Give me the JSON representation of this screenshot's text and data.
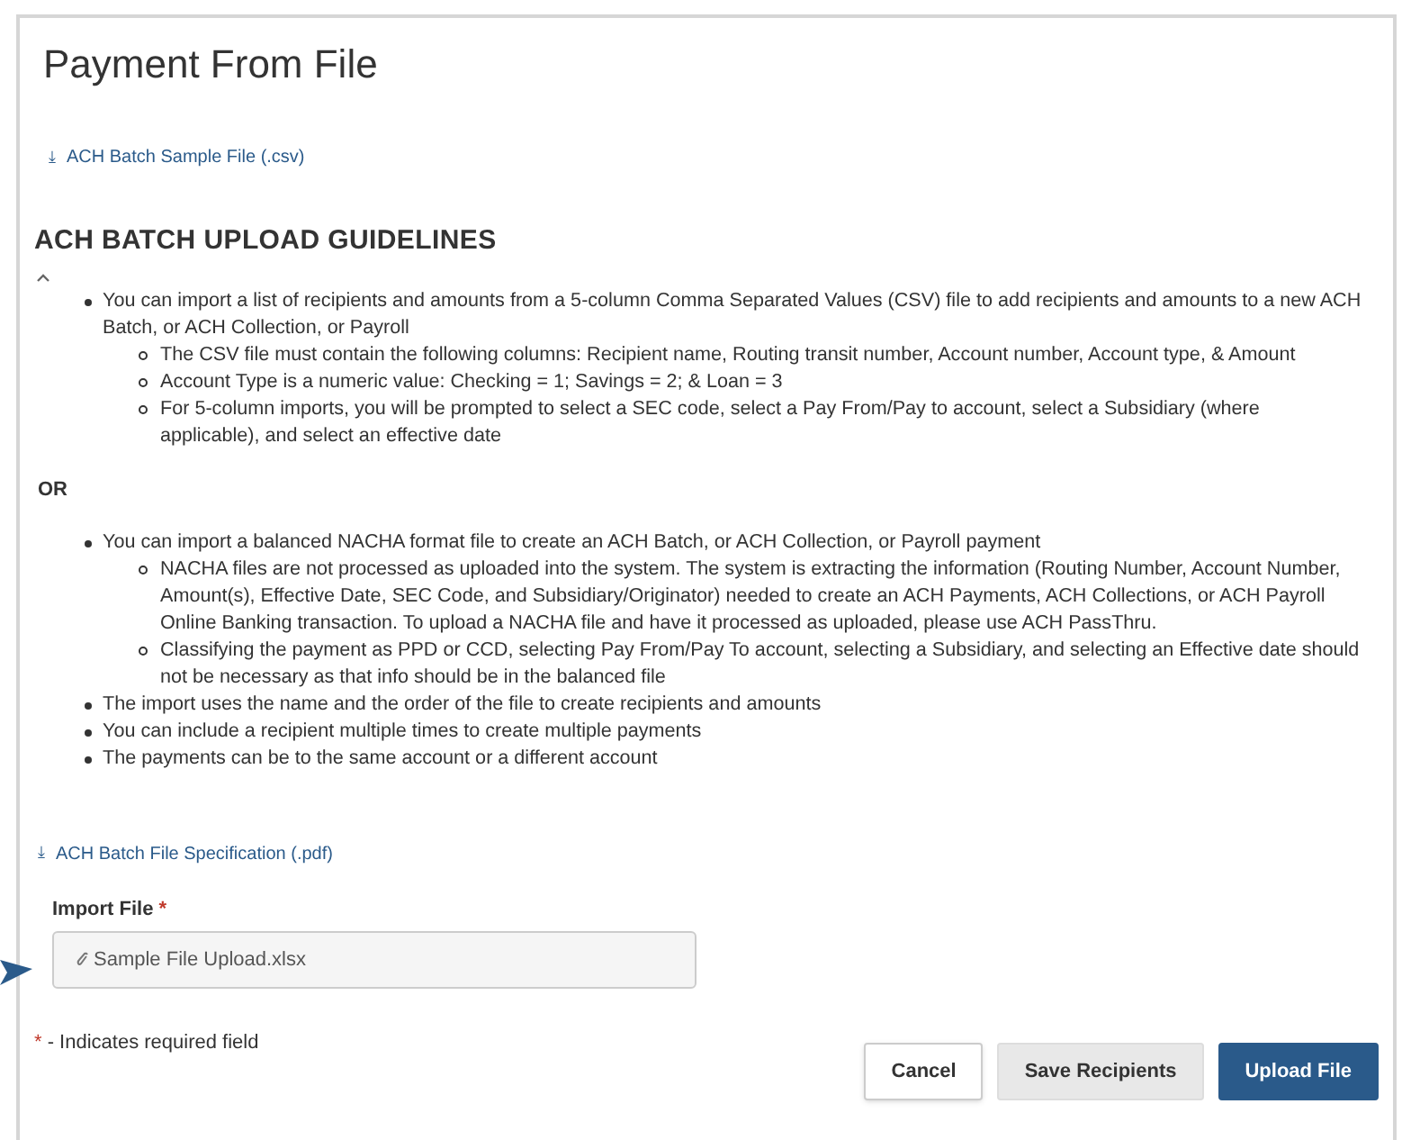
{
  "title": "Payment From File",
  "sample_link": {
    "icon": "⤓",
    "label": "ACH Batch Sample File (.csv)"
  },
  "guidelines": {
    "heading": "ACH BATCH UPLOAD GUIDELINES",
    "expanded": true,
    "groups": [
      {
        "items": [
          {
            "text": "You can import a list of recipients and amounts from a 5-column Comma Separated Values (CSV) file to add recipients and amounts to a new ACH Batch, or ACH Collection, or Payroll",
            "children": [
              {
                "text": "The CSV file must contain the following columns: Recipient name, Routing transit number, Account number, Account type, & Amount"
              },
              {
                "text": "Account Type is a numeric value: Checking = 1; Savings = 2; & Loan = 3"
              },
              {
                "text": "For 5-column imports, you will be prompted to select a SEC code, select a Pay From/Pay to account, select a Subsidiary (where applicable), and select an effective date"
              }
            ]
          }
        ]
      },
      {
        "separator": "OR",
        "items": [
          {
            "text": "You can import a balanced NACHA format file to create an ACH Batch, or ACH Collection, or Payroll payment",
            "children": [
              {
                "text": "NACHA files are not processed as uploaded into the system. The system is extracting the information (Routing Number, Account Number, Amount(s), Effective Date, SEC Code, and Subsidiary/Originator) needed to create an ACH Payments, ACH Collections, or ACH Payroll Online Banking transaction. To upload a NACHA file and have it processed as uploaded, please use ACH PassThru."
              },
              {
                "text": "Classifying the payment as PPD or CCD, selecting Pay From/Pay To account, selecting a Subsidiary, and selecting an Effective date should not be necessary as that info should be in the balanced file"
              }
            ]
          },
          {
            "text": "The import uses the name and the order of the file to create recipients and amounts"
          },
          {
            "text": "You can include a recipient multiple times to create multiple payments"
          },
          {
            "text": "The payments can be to the same account or a different account"
          }
        ]
      }
    ]
  },
  "spec_link": {
    "icon": "⤓",
    "label": "ACH Batch File Specification (.pdf)"
  },
  "import_field": {
    "label": "Import File",
    "required_mark": "*",
    "value": "Sample File Upload.xlsx"
  },
  "required_note": {
    "mark": "*",
    "text": "- Indicates required field"
  },
  "buttons": [
    {
      "label": "Cancel",
      "kind": "outline"
    },
    {
      "label": "Save Recipients",
      "kind": "secondary"
    },
    {
      "label": "Upload File",
      "kind": "primary"
    }
  ]
}
